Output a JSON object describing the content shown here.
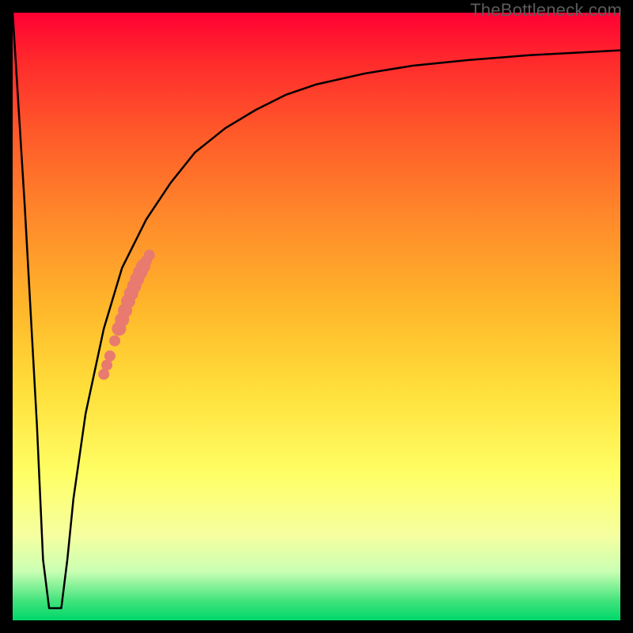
{
  "watermark": {
    "text": "TheBottleneck.com"
  },
  "colors": {
    "curve": "#000000",
    "dots": "#e97a6f",
    "background_top": "#ff0033",
    "background_bottom": "#00d86b"
  },
  "chart_data": {
    "type": "line",
    "title": "",
    "xlabel": "",
    "ylabel": "",
    "xlim": [
      0,
      100
    ],
    "ylim": [
      0,
      100
    ],
    "grid": false,
    "legend": false,
    "series": [
      {
        "name": "bottleneck-curve",
        "x": [
          0,
          2,
          4,
          5,
          6,
          7,
          8,
          9,
          10,
          12,
          15,
          18,
          22,
          26,
          30,
          35,
          40,
          45,
          50,
          58,
          66,
          75,
          85,
          100
        ],
        "y": [
          100,
          68,
          32,
          10,
          2,
          2,
          2,
          10,
          20,
          34,
          48,
          58,
          66,
          72,
          77,
          81,
          84,
          86.5,
          88.2,
          90,
          91.3,
          92.2,
          93,
          93.8
        ]
      }
    ],
    "overlay_points": {
      "name": "highlighted-segment-dots",
      "points": [
        {
          "x": 15.0,
          "y": 40.5
        },
        {
          "x": 15.5,
          "y": 42.0
        },
        {
          "x": 16.0,
          "y": 43.5
        },
        {
          "x": 16.8,
          "y": 46.0
        },
        {
          "x": 17.5,
          "y": 48.0
        },
        {
          "x": 18.0,
          "y": 49.5
        },
        {
          "x": 18.5,
          "y": 51.0
        },
        {
          "x": 19.0,
          "y": 52.5
        },
        {
          "x": 19.5,
          "y": 53.8
        },
        {
          "x": 20.0,
          "y": 55.0
        },
        {
          "x": 20.5,
          "y": 56.2
        },
        {
          "x": 21.0,
          "y": 57.3
        },
        {
          "x": 21.5,
          "y": 58.3
        },
        {
          "x": 22.0,
          "y": 59.2
        },
        {
          "x": 22.5,
          "y": 60.1
        }
      ]
    }
  }
}
